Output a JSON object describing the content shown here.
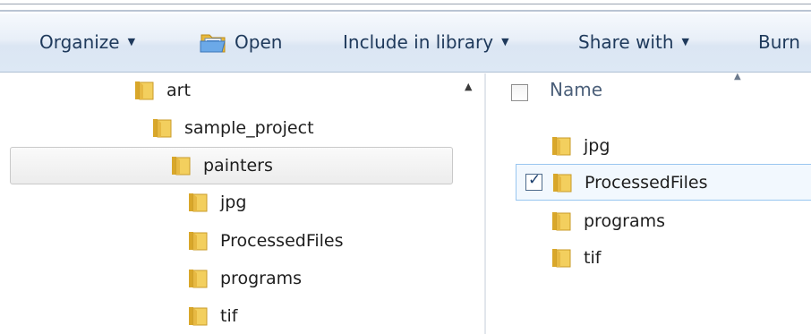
{
  "toolbar": {
    "organize": "Organize",
    "open": "Open",
    "include_in_library": "Include in library",
    "share_with": "Share with",
    "burn": "Burn"
  },
  "nav_tree": {
    "items": [
      {
        "label": "art"
      },
      {
        "label": "sample_project"
      },
      {
        "label": "painters",
        "selected": true
      },
      {
        "label": "jpg"
      },
      {
        "label": "ProcessedFiles"
      },
      {
        "label": "programs"
      },
      {
        "label": "tif"
      }
    ]
  },
  "file_list": {
    "column_name": "Name",
    "items": [
      {
        "label": "jpg",
        "checked": false
      },
      {
        "label": "ProcessedFiles",
        "checked": true
      },
      {
        "label": "programs",
        "checked": false
      },
      {
        "label": "tif",
        "checked": false
      }
    ]
  },
  "icons": {
    "folder": "folder-icon",
    "open": "open-icon",
    "dropdown": "chevron-down-icon",
    "scroll_up": "scroll-up-arrow-icon",
    "sort": "sort-ascending-icon"
  },
  "colors": {
    "toolbar_text": "#1e395b",
    "folder_yellow": "#f3cf5e",
    "selection_border": "#99c6f0",
    "selection_fill": "#f2f8fe"
  }
}
